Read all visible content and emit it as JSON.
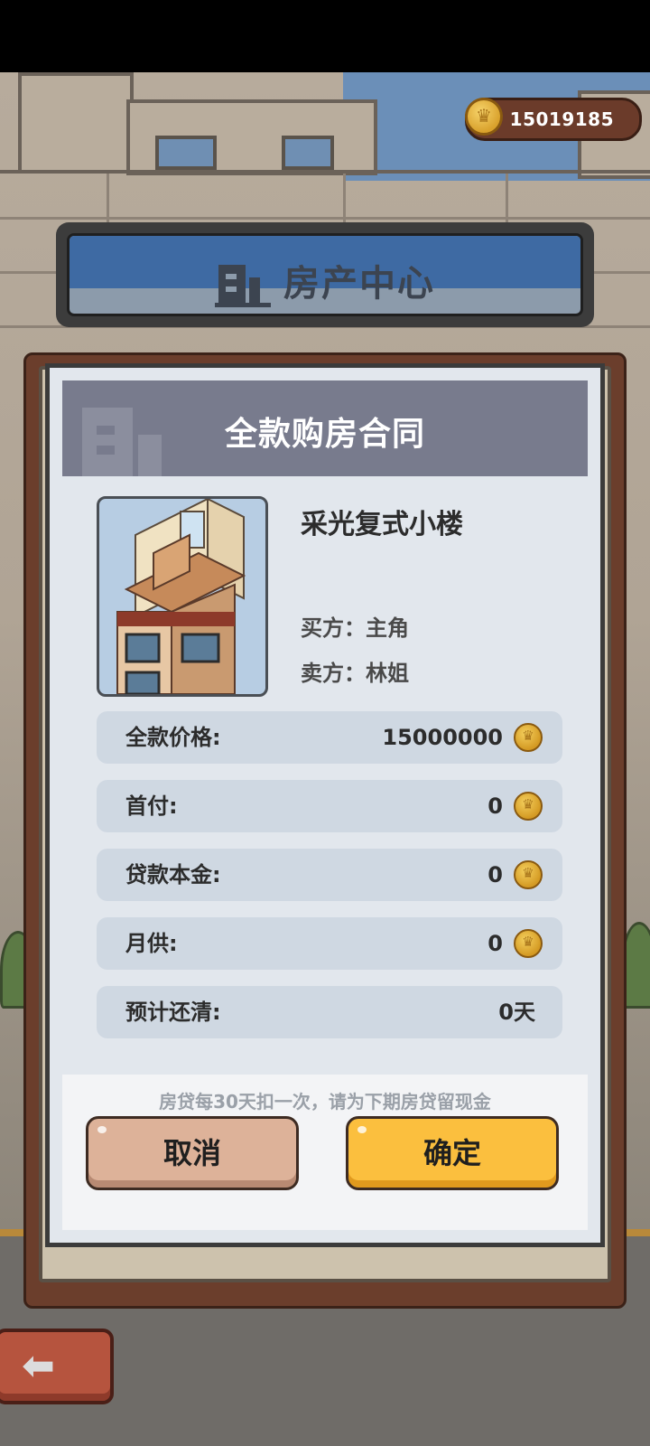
{
  "status_bar": {},
  "coins": {
    "balance": "15019185"
  },
  "header": {
    "title": "房产中心"
  },
  "contract": {
    "title": "全款购房合同",
    "property_name": "采光复式小楼",
    "buyer": "买方：主角",
    "seller": "卖方：林姐",
    "rows": [
      {
        "label": "全款价格:",
        "value": "15000000",
        "coin": true
      },
      {
        "label": "首付:",
        "value": "0",
        "coin": true
      },
      {
        "label": "贷款本金:",
        "value": "0",
        "coin": true
      },
      {
        "label": "月供:",
        "value": "0",
        "coin": true
      },
      {
        "label": "预计还清:",
        "value": "0天",
        "coin": false
      }
    ],
    "note": "房贷每30天扣一次，请为下期房贷留现金",
    "cancel_label": "取消",
    "confirm_label": "确定"
  },
  "icons": {
    "coin": "coin-icon",
    "building": "building-icon",
    "back": "back-arrow-icon"
  },
  "colors": {
    "confirm": "#fbbf3e",
    "cancel": "#ddb299",
    "header_blue": "#3e6aa3",
    "contract_header": "#787b8d"
  }
}
